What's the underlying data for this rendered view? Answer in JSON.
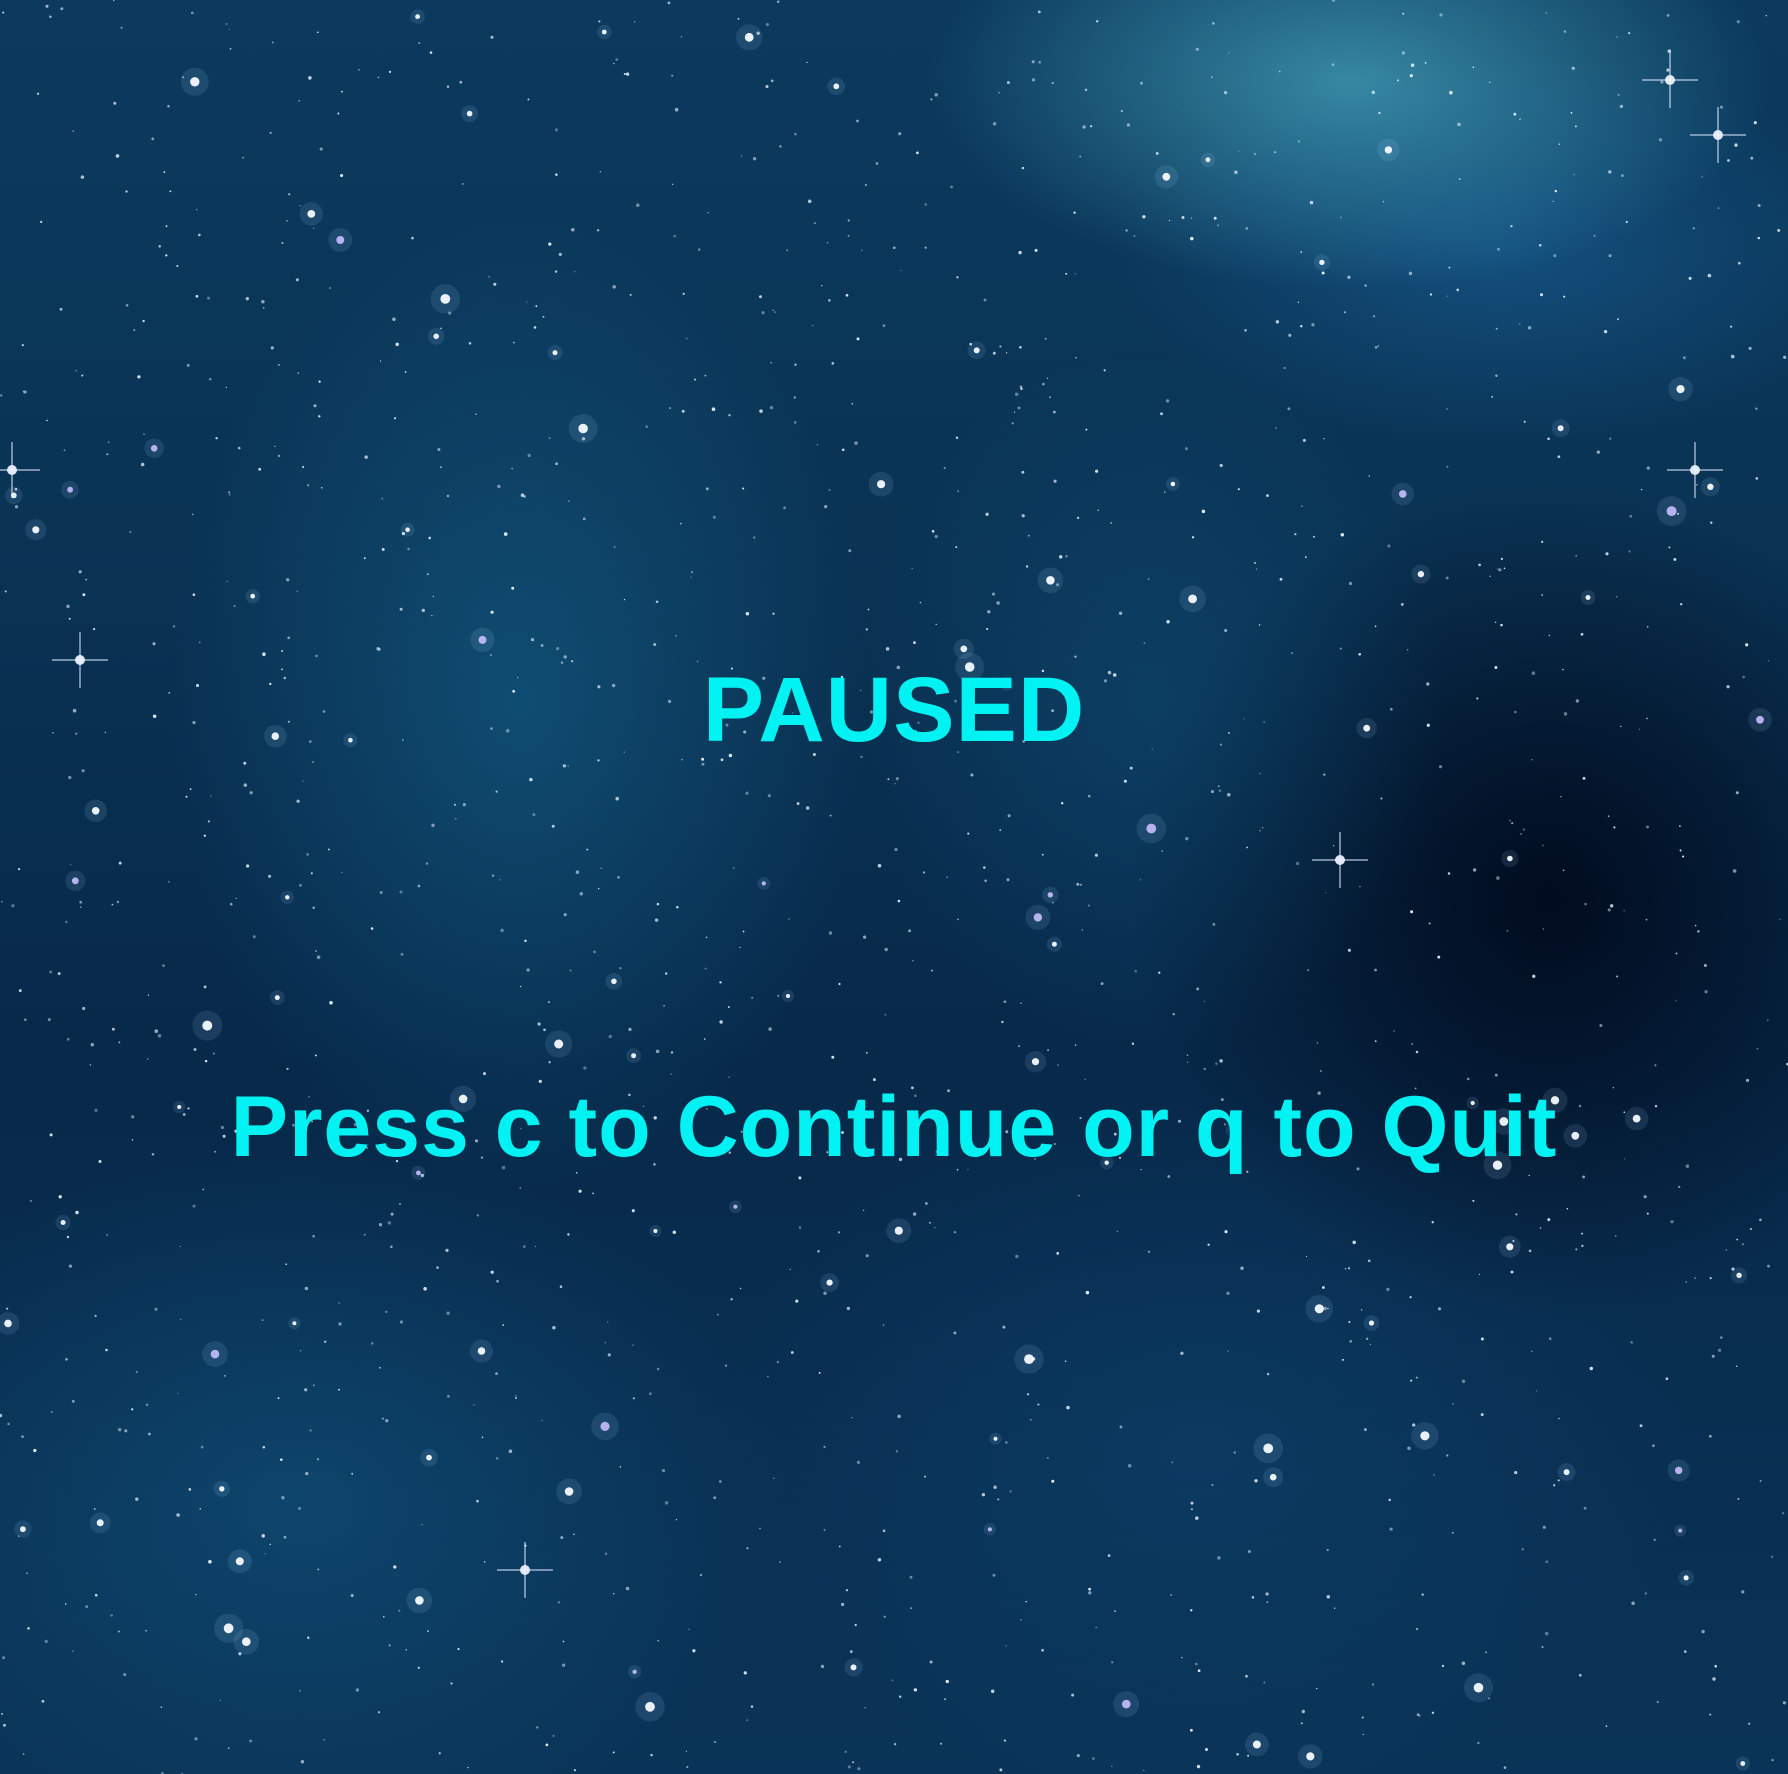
{
  "pause_screen": {
    "title": "PAUSED",
    "instructions": "Press c to Continue or q to Quit"
  },
  "colors": {
    "text": "#00f2f2",
    "background_deep": "#07294a",
    "nebula_highlight": "#5ac8dc"
  },
  "background": {
    "type": "starfield-nebula-icon"
  }
}
